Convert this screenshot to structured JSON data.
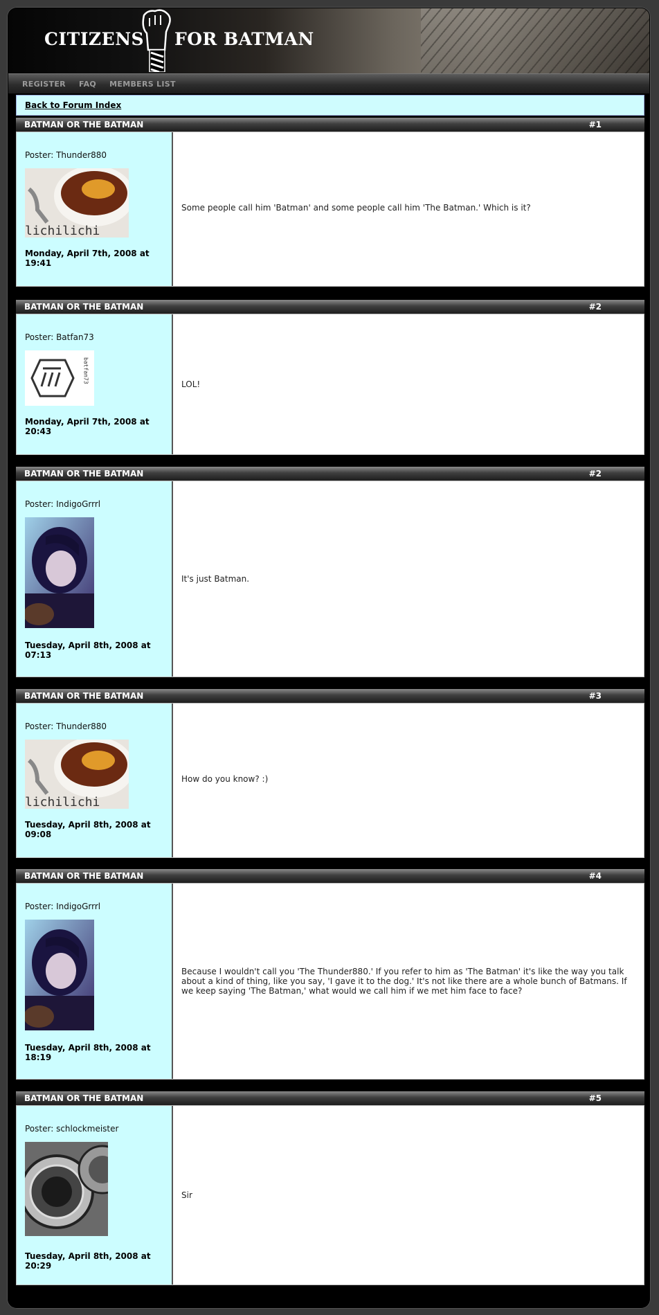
{
  "site": {
    "logo_left": "CITIZENS",
    "logo_right": "FOR BATMAN"
  },
  "nav": [
    "REGISTER",
    "FAQ",
    "MEMBERS LIST"
  ],
  "back_link": "Back to Forum Index",
  "posts": [
    {
      "title": "BATMAN OR THE BATMAN",
      "number": "#1",
      "poster": "Poster: Thunder880",
      "avatar": "chili-avatar",
      "avatar_caption": "lichilichi",
      "date": "Monday, April 7th, 2008 at 19:41",
      "message": "Some people call him 'Batman' and some people call him 'The Batman.' Which is it?"
    },
    {
      "title": "BATMAN OR THE BATMAN",
      "number": "#2",
      "poster": "Poster: Batfan73",
      "avatar": "hexagon-avatar",
      "avatar_caption": "batfan73",
      "date": "Monday, April 7th, 2008 at 20:43",
      "message": "LOL!"
    },
    {
      "title": "BATMAN OR THE BATMAN",
      "number": "#2",
      "poster": "Poster: IndigoGrrrl",
      "avatar": "girl-guitar-avatar",
      "date": "Tuesday, April 8th, 2008 at 07:13",
      "message": "It's just Batman."
    },
    {
      "title": "BATMAN OR THE BATMAN",
      "number": "#3",
      "poster": "Poster: Thunder880",
      "avatar": "chili-avatar",
      "avatar_caption": "lichilichi",
      "date": "Tuesday, April 8th, 2008 at 09:08",
      "message": "How do you know? :)"
    },
    {
      "title": "BATMAN OR THE BATMAN",
      "number": "#4",
      "poster": "Poster: IndigoGrrrl",
      "avatar": "girl-guitar-avatar",
      "date": "Tuesday, April 8th, 2008 at 18:19",
      "message": "Because I wouldn't call you 'The Thunder880.' If you refer to him as 'The Batman' it's like the way you talk about a kind of thing, like you say, 'I gave it to the dog.' It's not like there are a whole bunch of Batmans. If we keep saying 'The Batman,' what would we call him if we met him face to face?"
    },
    {
      "title": "BATMAN OR THE BATMAN",
      "number": "#5",
      "poster": "Poster: schlockmeister",
      "avatar": "camera-lens-avatar",
      "date": "Tuesday, April 8th, 2008 at 20:29",
      "message": "Sir"
    }
  ]
}
